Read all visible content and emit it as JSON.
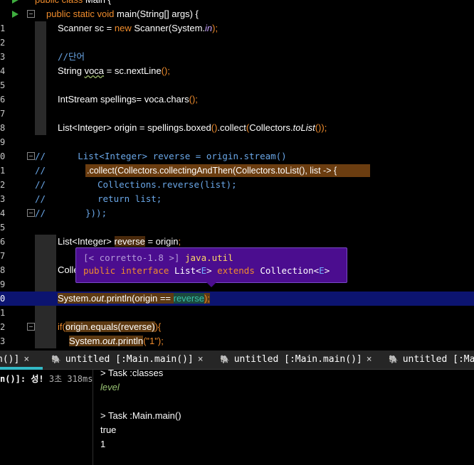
{
  "editor": {
    "lines": [
      {
        "num": "",
        "code": "public class Main {"
      },
      {
        "num": "",
        "code": "public static void main(String[] args) {"
      },
      {
        "num": "1",
        "code": "Scanner sc = new Scanner(System.in);"
      },
      {
        "num": "2",
        "code": ""
      },
      {
        "num": "3",
        "code": "//단어"
      },
      {
        "num": "4",
        "code": "String voca = sc.nextLine();"
      },
      {
        "num": "5",
        "code": ""
      },
      {
        "num": "6",
        "code": "IntStream spellings= voca.chars();"
      },
      {
        "num": "7",
        "code": ""
      },
      {
        "num": "8",
        "code": "List<Integer> origin = spellings.boxed().collect(Collectors.toList());"
      },
      {
        "num": "9",
        "code": ""
      },
      {
        "num": "0",
        "code": "//      List<Integer> reverse = origin.stream()"
      },
      {
        "num": "1",
        "code": "//              .collect(Collectors.collectingAndThen(Collectors.toList(), list -> {"
      },
      {
        "num": "2",
        "code": "//                  Collections.reverse(list);"
      },
      {
        "num": "3",
        "code": "//                  return list;"
      },
      {
        "num": "4",
        "code": "//              }));"
      },
      {
        "num": "5",
        "code": ""
      },
      {
        "num": "6",
        "code": "List<Integer> reverse = origin;"
      },
      {
        "num": "7",
        "code": ""
      },
      {
        "num": "8",
        "code": "Colle"
      },
      {
        "num": "9",
        "code": ""
      },
      {
        "num": "0",
        "code": "System.out.println(origin == reverse);"
      },
      {
        "num": "1",
        "code": ""
      },
      {
        "num": "2",
        "code": "if(origin.equals(reverse)){"
      },
      {
        "num": "3",
        "code": "System.out.println(\"1\");"
      }
    ],
    "tooltip": {
      "line1_prefix": "[< corretto-1.8 >] ",
      "line1_pkg": "java.util",
      "line2_kw1": "public interface ",
      "line2_type": "List",
      "line2_lt": "<",
      "line2_E1": "E",
      "line2_gt": ">",
      "line2_kw2": " extends ",
      "line2_type2": "Collection",
      "line2_E2": "E"
    }
  },
  "tabs": [
    {
      "label": "n()]",
      "active": true
    },
    {
      "label": "untitled [:Main.main()]",
      "active": false
    },
    {
      "label": "untitled [:Main.main()]",
      "active": false
    },
    {
      "label": "untitled [:Ma",
      "active": false
    }
  ],
  "run": {
    "status_label": "n()]: 성!",
    "duration": "3초 318ms"
  },
  "console": {
    "lines": [
      {
        "text": "> Task :classes",
        "style": "normal"
      },
      {
        "text": "level",
        "style": "green"
      },
      {
        "text": "",
        "style": "normal"
      },
      {
        "text": "> Task :Main.main()",
        "style": "normal"
      },
      {
        "text": "true",
        "style": "normal"
      },
      {
        "text": "1",
        "style": "normal"
      }
    ]
  },
  "colors": {
    "keyword": "#f08c2c",
    "comment": "#6aa7e8",
    "highlight_line": "#0c1470",
    "tooltip_bg": "#4b0d8f",
    "run_icon": "#3fae3f"
  }
}
